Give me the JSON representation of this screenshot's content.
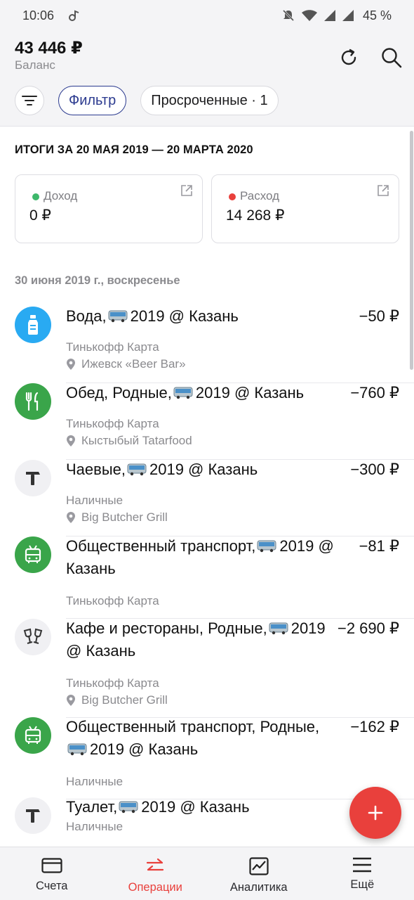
{
  "status_bar": {
    "time": "10:06",
    "battery": "45 %"
  },
  "header": {
    "balance": "43 446 ₽",
    "balance_label": "Баланс"
  },
  "filters": {
    "filter_label": "Фильтр",
    "overdue_label": "Просроченные · 1"
  },
  "summary": {
    "title": "ИТОГИ ЗА 20 МАЯ 2019 — 20 МАРТА 2020",
    "income": {
      "label": "Доход",
      "value": "0 ₽",
      "color": "#3db86b"
    },
    "expense": {
      "label": "Расход",
      "value": "14 268 ₽",
      "color": "#e9403c"
    }
  },
  "date_header": "30 июня 2019 г., воскресенье",
  "transactions": [
    {
      "title_before": "Вода,",
      "title_after": "2019 @ Казань",
      "amount": "−50 ₽",
      "account": "Тинькофф Карта",
      "place": "Ижевск «Beer Bar»",
      "icon": "bottle-icon",
      "icon_bg": "#29aaf2"
    },
    {
      "title_before": "Обед, Родные,",
      "title_after": "2019 @ Казань",
      "amount": "−760 ₽",
      "account": "Тинькофф Карта",
      "place": "Кыстыбый Tatarfood",
      "icon": "fork-knife-icon",
      "icon_bg": "#3aa54a"
    },
    {
      "title_before": "Чаевые,",
      "title_after": "2019 @ Казань",
      "amount": "−300 ₽",
      "account": "Наличные",
      "place": "Big Butcher Grill",
      "icon": "hammer-icon",
      "icon_bg": "#f0f0f3"
    },
    {
      "title_before": "Общественный транспорт,",
      "title_after": "2019 @ Казань",
      "amount": "−81 ₽",
      "account": "Тинькофф Карта",
      "place": "",
      "icon": "trolleybus-icon",
      "icon_bg": "#3aa54a"
    },
    {
      "title_before": "Кафе и рестораны, Родные,",
      "title_after": "2019 @ Казань",
      "amount": "−2 690 ₽",
      "account": "Тинькофф Карта",
      "place": "Big Butcher Grill",
      "icon": "wine-glasses-icon",
      "icon_bg": "#f0f0f3"
    },
    {
      "title_before": "Общественный транспорт, Родные,",
      "title_after": "2019 @ Казань",
      "amount": "−162 ₽",
      "account": "Наличные",
      "place": "",
      "icon": "trolleybus-icon",
      "icon_bg": "#3aa54a"
    },
    {
      "title_before": "Туалет,",
      "title_after": "2019 @ Казань",
      "amount": "",
      "account": "Наличные",
      "place": "",
      "icon": "hammer-icon",
      "icon_bg": "#f0f0f3"
    }
  ],
  "bottom_nav": [
    {
      "label": "Счета",
      "icon": "card-icon",
      "active": false
    },
    {
      "label": "Операции",
      "icon": "transfer-arrows-icon",
      "active": true
    },
    {
      "label": "Аналитика",
      "icon": "chart-icon",
      "active": false
    },
    {
      "label": "Ещё",
      "icon": "menu-icon",
      "active": false
    }
  ],
  "colors": {
    "accent": "#e9403c",
    "filter_active": "#2b3a8f"
  }
}
